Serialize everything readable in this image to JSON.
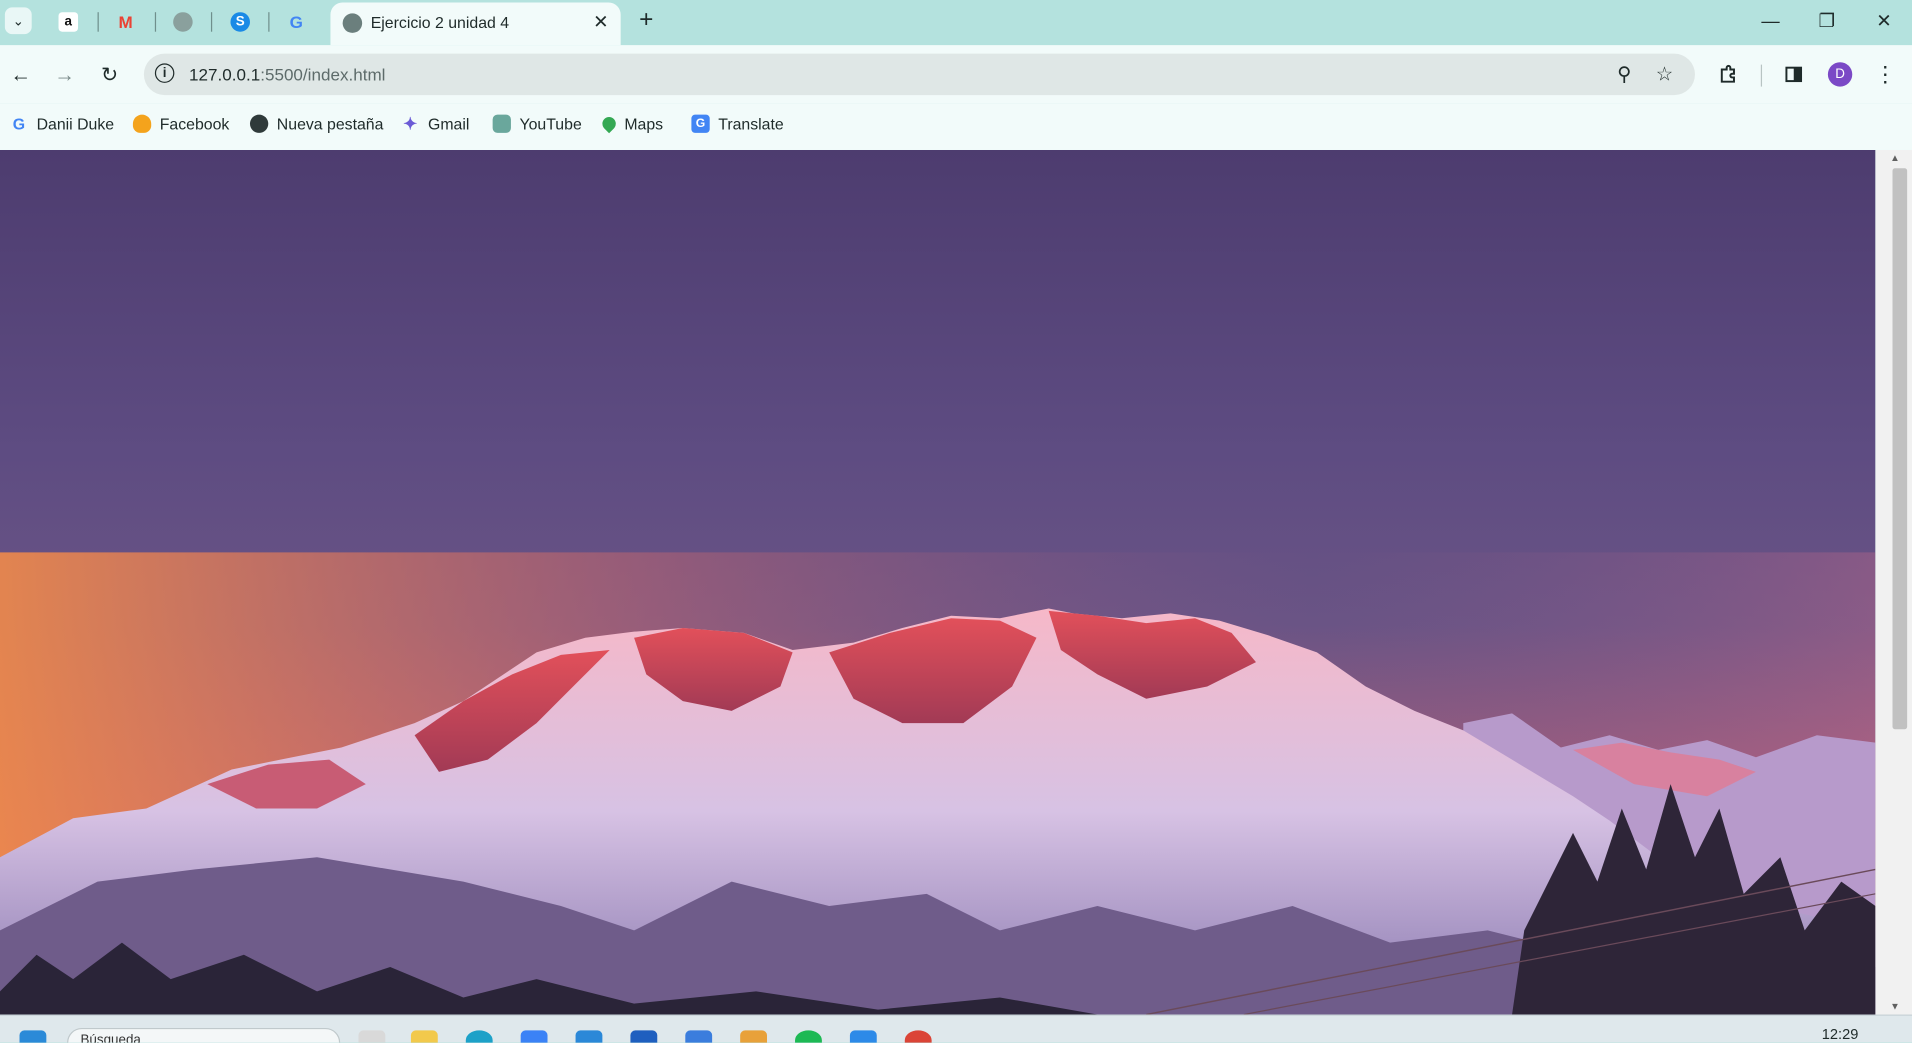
{
  "browser": {
    "pinned_tabs": [
      {
        "icon": "amazon-icon",
        "glyph": "a",
        "color": "#ffffff"
      },
      {
        "icon": "gmail-icon",
        "glyph": "M",
        "color": "#ea4335"
      },
      {
        "icon": "globe-icon",
        "glyph": "",
        "color": "#8aa09d"
      },
      {
        "icon": "skype-icon",
        "glyph": "S",
        "color": "#1a8ae6"
      },
      {
        "icon": "google-icon",
        "glyph": "G",
        "color": "#4285f4"
      }
    ],
    "active_tab": {
      "title": "Ejercicio 2 unidad 4",
      "close": "✕"
    },
    "new_tab": "+",
    "window_controls": {
      "minimize": "—",
      "restore": "❐",
      "close": "✕"
    }
  },
  "toolbar": {
    "back": "←",
    "forward": "→",
    "reload": "↻",
    "url_host": "127.0.0.1",
    "url_path": ":5500/index.html",
    "zoom_icon": "⚲",
    "star_icon": "☆",
    "avatar_letter": "D",
    "menu": "⋮"
  },
  "bookmarks": [
    {
      "label": "Danii Duke",
      "icon": "google-icon",
      "glyph": "G",
      "color": "#4285f4"
    },
    {
      "label": "Facebook",
      "icon": "flame-icon",
      "glyph": "",
      "color": "#f4a31c"
    },
    {
      "label": "Nueva pestaña",
      "icon": "globe-icon",
      "glyph": "",
      "color": "#2f3a3a"
    },
    {
      "label": "Gmail",
      "icon": "sparkle-icon",
      "glyph": "✦",
      "color": "#6b5bd6"
    },
    {
      "label": "YouTube",
      "icon": "chatgpt-icon",
      "glyph": "",
      "color": "#6aa79c"
    },
    {
      "label": "Maps",
      "icon": "maps-pin-icon",
      "glyph": "",
      "color": "#34a853"
    },
    {
      "label": "Translate",
      "icon": "translate-icon",
      "glyph": "G",
      "color": "#4285f4"
    }
  ],
  "taskbar": {
    "search_placeholder": "Búsqueda",
    "time": "12:29"
  }
}
